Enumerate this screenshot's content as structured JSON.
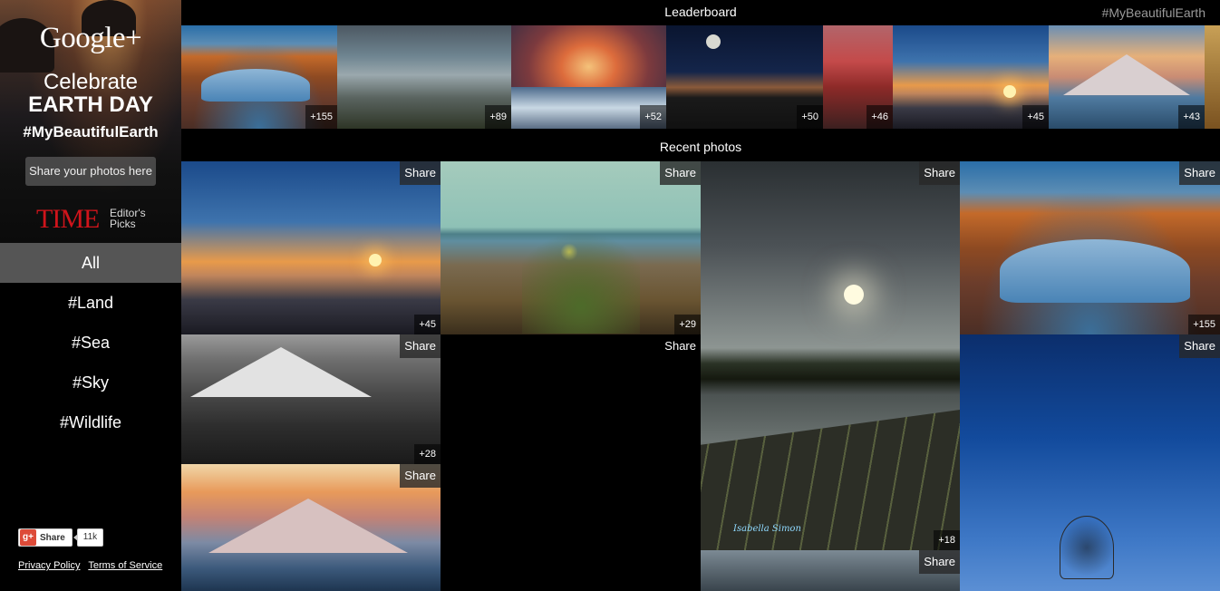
{
  "sidebar": {
    "logo_text": "Google+",
    "celebrate": "Celebrate",
    "earth_day": "EARTH DAY",
    "hashtag": "#MyBeautifulEarth",
    "share_button": "Share your photos here",
    "time_logo": "TIME",
    "editors_picks": "Editor's Picks",
    "nav": [
      {
        "label": "All",
        "active": true
      },
      {
        "label": "#Land",
        "active": false
      },
      {
        "label": "#Sea",
        "active": false
      },
      {
        "label": "#Sky",
        "active": false
      },
      {
        "label": "#Wildlife",
        "active": false
      }
    ],
    "gplus_share": {
      "icon": "g+",
      "label": "Share",
      "count": "11k"
    },
    "links": {
      "privacy": "Privacy Policy",
      "terms": "Terms of Service"
    }
  },
  "header": {
    "leaderboard_title": "Leaderboard",
    "hashtag": "#MyBeautifulEarth",
    "recent_title": "Recent photos"
  },
  "leaderboard": [
    {
      "style": "p-arch",
      "count": "+155"
    },
    {
      "style": "p-storm",
      "count": "+89"
    },
    {
      "style": "p-sunsetfire",
      "count": "+52"
    },
    {
      "style": "p-nightroad",
      "count": "+50"
    },
    {
      "style": "p-redrock",
      "count": "+46"
    },
    {
      "style": "p-beach",
      "count": "+45"
    },
    {
      "style": "p-mtn",
      "count": "+43"
    },
    {
      "style": "p-edge",
      "count": ""
    }
  ],
  "recent": [
    {
      "style": "p-beach",
      "share": "Share",
      "count": "+45"
    },
    {
      "style": "p-grass",
      "share": "Share",
      "count": "+29"
    },
    {
      "style": "p-lake",
      "share": "Share",
      "count": "+18"
    },
    {
      "style": "p-arch",
      "share": "Share",
      "count": "+155"
    },
    {
      "style": "p-bwmtn",
      "share": "Share",
      "count": "+28"
    },
    {
      "style": "empty",
      "share": "Share",
      "count": ""
    },
    {
      "style": "p-bluesky",
      "share": "Share",
      "count": ""
    },
    {
      "style": "p-mtn2",
      "share": "Share",
      "count": ""
    },
    {
      "style": "p-stormsmall",
      "share": "Share",
      "count": ""
    }
  ],
  "photo_credit": "Isabella Simon",
  "colors": {
    "nav_active_bg": "#555555",
    "time_red": "#d0141b",
    "gplus_red": "#dd4b39"
  }
}
